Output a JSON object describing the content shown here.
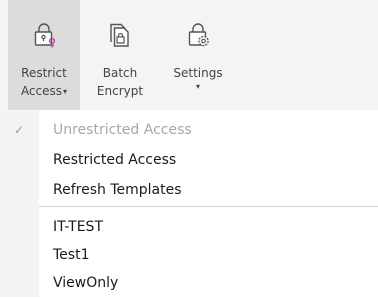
{
  "ribbon": {
    "restrict_access": {
      "line1": "Restrict",
      "line2": "Access",
      "caret": "▾"
    },
    "batch_encrypt": {
      "line1": "Batch",
      "line2": "Encrypt"
    },
    "settings": {
      "line1": "Settings",
      "caret": "▾"
    }
  },
  "menu": {
    "items": [
      {
        "label": "Unrestricted Access",
        "state": "checked-disabled",
        "check": "✓"
      },
      {
        "label": "Restricted Access"
      },
      {
        "label": "Refresh Templates"
      },
      {
        "label": "IT-TEST"
      },
      {
        "label": "Test1"
      },
      {
        "label": "ViewOnly"
      }
    ]
  },
  "colors": {
    "ribbon_bg": "#f4f4f4",
    "active_bg": "#dcdcdc",
    "key_accent": "#b04ab0",
    "disabled_text": "#a7a7a7"
  }
}
